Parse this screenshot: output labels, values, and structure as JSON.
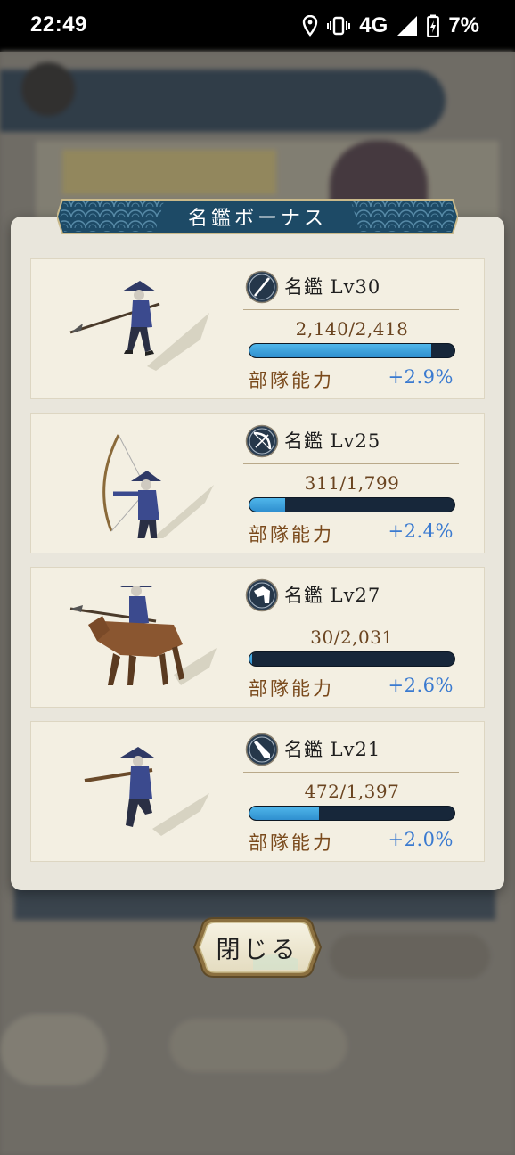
{
  "status_bar": {
    "time": "22:49",
    "network": "4G",
    "battery": "7%",
    "icons": [
      "location-icon",
      "vibrate-icon",
      "signal-icon",
      "battery-charging-icon"
    ]
  },
  "dialog": {
    "title": "名鑑ボーナス",
    "cards": [
      {
        "unit": "spearman",
        "type_icon": "spear-icon",
        "level_label": "名鑑 Lv30",
        "count_text": "2,140/2,418",
        "progress": 0.885,
        "ability_label": "部隊能力",
        "bonus": "+2.9%"
      },
      {
        "unit": "archer",
        "type_icon": "bow-icon",
        "level_label": "名鑑 Lv25",
        "count_text": "311/1,799",
        "progress": 0.173,
        "ability_label": "部隊能力",
        "bonus": "+2.4%"
      },
      {
        "unit": "cavalry",
        "type_icon": "horse-icon",
        "level_label": "名鑑 Lv27",
        "count_text": "30/2,031",
        "progress": 0.015,
        "ability_label": "部隊能力",
        "bonus": "+2.6%"
      },
      {
        "unit": "gunner",
        "type_icon": "gun-icon",
        "level_label": "名鑑 Lv21",
        "count_text": "472/1,397",
        "progress": 0.338,
        "ability_label": "部隊能力",
        "bonus": "+2.0%"
      }
    ],
    "close_label": "閉じる"
  },
  "colors": {
    "accent_bar": "#3aa3de",
    "bonus_text": "#3a7ad0",
    "title_banner": "#1d4a66"
  }
}
